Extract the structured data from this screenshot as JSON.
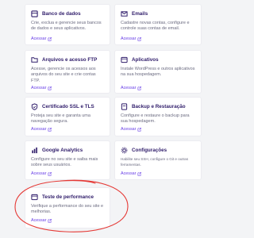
{
  "colors": {
    "brand": "#2f1c6a",
    "link": "#673de6",
    "desc": "#6b6b80",
    "annotation": "#e53935"
  },
  "cards": [
    {
      "title": "Banco de dados",
      "desc": "Crie, exclua e gerencie seus bancos de dados e seus aplicativos.",
      "link": "Acessar",
      "icon": "database-icon"
    },
    {
      "title": "Emails",
      "desc": "Cadastre novas contas, configure e controle suas contas de email.",
      "link": "Acessar",
      "icon": "mail-icon"
    },
    {
      "title": "Arquivos e acesso FTP",
      "desc": "Acesse, gerencie os acessos aos arquivos do seu site e crie contas FTP.",
      "link": "Acessar",
      "icon": "folder-icon"
    },
    {
      "title": "Aplicativos",
      "desc": "Instale WordPress e outros aplicativos na sua hospedagem.",
      "link": "Acessar",
      "icon": "apps-icon"
    },
    {
      "title": "Certificado SSL e TLS",
      "desc": "Proteja seu site e garanta uma navegação segura.",
      "link": "Acessar",
      "icon": "ssl-shield-icon"
    },
    {
      "title": "Backup e Restauração",
      "desc": "Configure e restaure o backup para sua hospedagem.",
      "link": "Acessar",
      "icon": "backup-icon"
    },
    {
      "title": "Google Analytics",
      "desc": "Configure no seu site e saiba mais sobre seus usuários.",
      "link": "Acessar",
      "icon": "analytics-icon"
    },
    {
      "title": "Configurações",
      "desc": "Habilite seu SSH, configure o Git e outras ferramentas.",
      "link": "Acessar",
      "icon": "settings-icon"
    },
    {
      "title": "Teste de performance",
      "desc": "Verifique a performance do seu site e melhorias.",
      "link": "Acessar",
      "icon": "performance-icon"
    }
  ]
}
